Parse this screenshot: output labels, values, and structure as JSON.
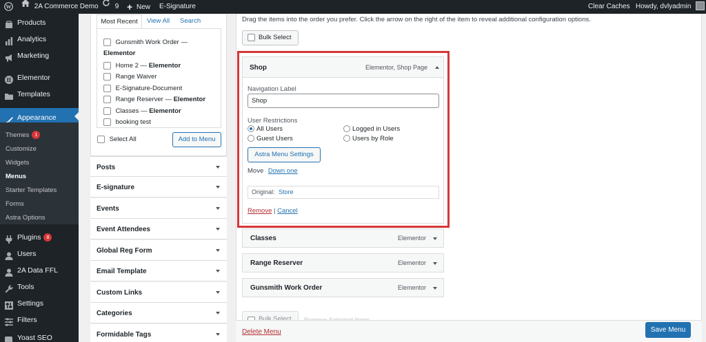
{
  "adminbar": {
    "site_name": "2A Commerce Demo",
    "updates_count": "9",
    "new_label": "New",
    "esig_label": "E-Signature",
    "clear_caches": "Clear Caches",
    "howdy": "Howdy, dvlyadmin"
  },
  "adminmenu": {
    "items": [
      {
        "label": "Products",
        "icon": "products-icon"
      },
      {
        "label": "Analytics",
        "icon": "analytics-icon"
      },
      {
        "label": "Marketing",
        "icon": "marketing-icon"
      },
      {
        "label": "Elementor",
        "icon": "elementor-icon"
      },
      {
        "label": "Templates",
        "icon": "templates-icon"
      },
      {
        "label": "Appearance",
        "icon": "appearance-icon"
      }
    ],
    "submenu": [
      {
        "label": "Themes",
        "badge": "1"
      },
      {
        "label": "Customize"
      },
      {
        "label": "Widgets"
      },
      {
        "label": "Menus"
      },
      {
        "label": "Starter Templates"
      },
      {
        "label": "Forms"
      },
      {
        "label": "Astra Options"
      }
    ],
    "items_after": [
      {
        "label": "Plugins",
        "badge": "8",
        "icon": "plugins-icon"
      },
      {
        "label": "Users",
        "icon": "users-icon"
      },
      {
        "label": "2A Data FFL",
        "icon": "data-icon"
      },
      {
        "label": "Tools",
        "icon": "tools-icon"
      },
      {
        "label": "Settings",
        "icon": "settings-icon"
      },
      {
        "label": "Filters",
        "icon": "filters-icon"
      },
      {
        "label": "Yoast SEO",
        "icon": "yoast-icon"
      }
    ]
  },
  "pages_box": {
    "tabs": [
      "Most Recent",
      "View All",
      "Search"
    ],
    "items": [
      {
        "title": "Gunsmith Work Order —",
        "suffix": "Elementor"
      },
      {
        "title": "Home 2 —",
        "suffix": "Elementor"
      },
      {
        "title": "Range Waiver",
        "suffix": ""
      },
      {
        "title": "E-Signature-Document",
        "suffix": ""
      },
      {
        "title": "Range Reserver —",
        "suffix": "Elementor"
      },
      {
        "title": "Classes —",
        "suffix": "Elementor"
      },
      {
        "title": "booking test",
        "suffix": ""
      }
    ],
    "select_all": "Select All",
    "add_to_menu": "Add to Menu"
  },
  "accordions": [
    "Posts",
    "E-signature",
    "Events",
    "Event Attendees",
    "Global Reg Form",
    "Email Template",
    "Custom Links",
    "Categories",
    "Formidable Tags"
  ],
  "menu_structure": {
    "instructions": "Drag the items into the order you prefer. Click the arrow on the right of the item to reveal additional configuration options.",
    "bulk_select": "Bulk Select",
    "bulk_select_bottom": "Bulk Select",
    "remove_selected": "Remove Selected Items",
    "expanded": {
      "title": "Shop",
      "type": "Elementor, Shop Page",
      "nav_label_caption": "Navigation Label",
      "nav_label_value": "Shop",
      "restrictions_caption": "User Restrictions",
      "options": [
        "All Users",
        "Logged in Users",
        "Guest Users",
        "Users by Role"
      ],
      "selected_option": "All Users",
      "astra_button": "Astra Menu Settings",
      "move_label": "Move",
      "move_link": "Down one",
      "original_label": "Original:",
      "original_link": "Store",
      "remove": "Remove",
      "separator": "|",
      "cancel": "Cancel"
    },
    "items": [
      {
        "title": "Classes",
        "type": "Elementor"
      },
      {
        "title": "Range Reserver",
        "type": "Elementor"
      },
      {
        "title": "Gunsmith Work Order",
        "type": "Elementor"
      }
    ]
  },
  "footer": {
    "delete_menu": "Delete Menu",
    "save_menu": "Save Menu"
  },
  "colors": {
    "accent": "#2271b1",
    "highlight_border": "#d63638",
    "adminbar": "#1d2327",
    "delete": "#b32d2e"
  }
}
